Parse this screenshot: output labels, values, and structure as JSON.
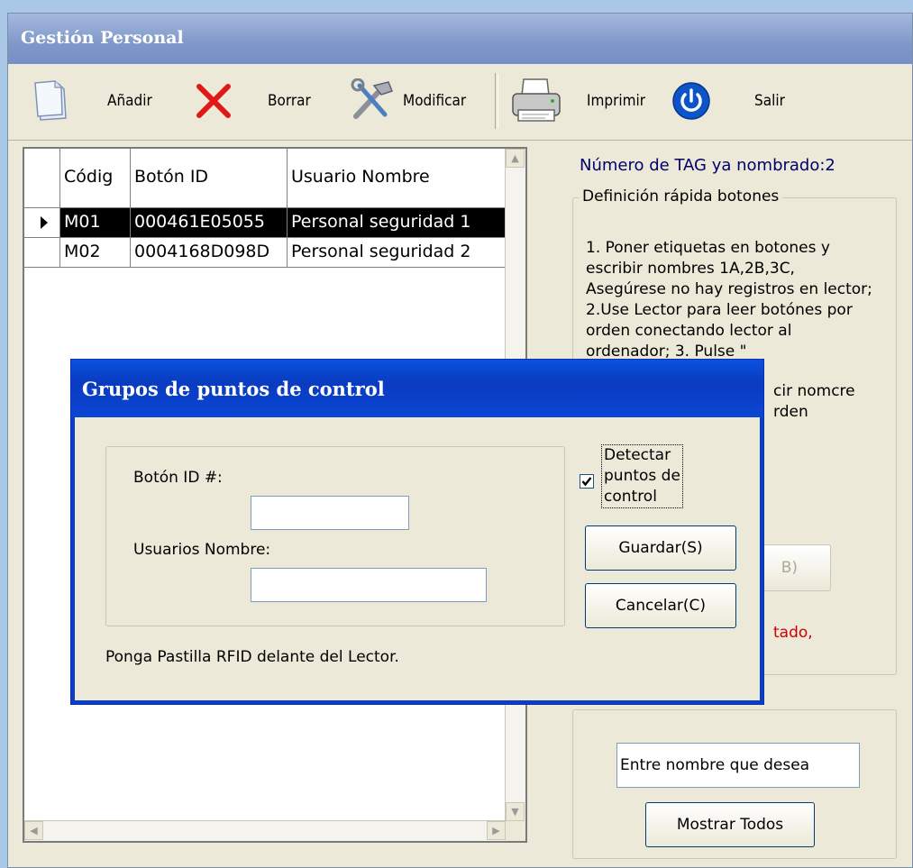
{
  "window": {
    "title": "Gestión Personal"
  },
  "toolbar": {
    "add_label": "Añadir",
    "delete_label": "Borrar",
    "modify_label": "Modificar",
    "print_label": "Imprimir",
    "exit_label": "Salir"
  },
  "grid": {
    "columns": [
      "Códig",
      "Botón ID",
      "Usuario Nombre"
    ],
    "rows": [
      {
        "code": "M01",
        "button_id": "000461E05055",
        "name": "Personal seguridad 1",
        "selected": true
      },
      {
        "code": "M02",
        "button_id": "0004168D098D",
        "name": "Personal seguridad 2",
        "selected": false
      }
    ]
  },
  "right_panel": {
    "tag_count": "Número de TAG ya nombrado:2",
    "quick_def_legend": "Definición rápida botones",
    "instructions_visible": "1. Poner etiquetas en botones y escribir nombres 1A,2B,3C, Asegúrese no hay registros en lector; 2.Use Lector para leer botónes por orden conectando lector al ordenador; 3. Pulse \"",
    "instr_tail_1": "cir nomcre",
    "instr_tail_2": "rden",
    "hidden_button_fragment": "B)",
    "red_fragment": "tado,",
    "search_input_value": "Entre nombre que desea",
    "show_all_label": "Mostrar Todos"
  },
  "dialog": {
    "title": "Grupos de puntos de control",
    "button_id_label": "Botón ID #:",
    "button_id_value": "",
    "user_name_label": "Usuarios Nombre:",
    "user_name_value": "",
    "detect_line1": "Detectar",
    "detect_line2": "puntos de",
    "detect_line3": "control",
    "detect_checked": true,
    "save_label": "Guardar(S)",
    "cancel_label": "Cancelar(C)",
    "hint": "Ponga Pastilla RFID delante del Lector."
  },
  "colors": {
    "title_blue": "#0a3ec4",
    "tag_text": "#00006b",
    "red_text": "#d00000",
    "exit_blue": "#0b55c8"
  },
  "icons": [
    "new-document-icon",
    "delete-x-icon",
    "tools-icon",
    "printer-icon",
    "power-icon"
  ]
}
